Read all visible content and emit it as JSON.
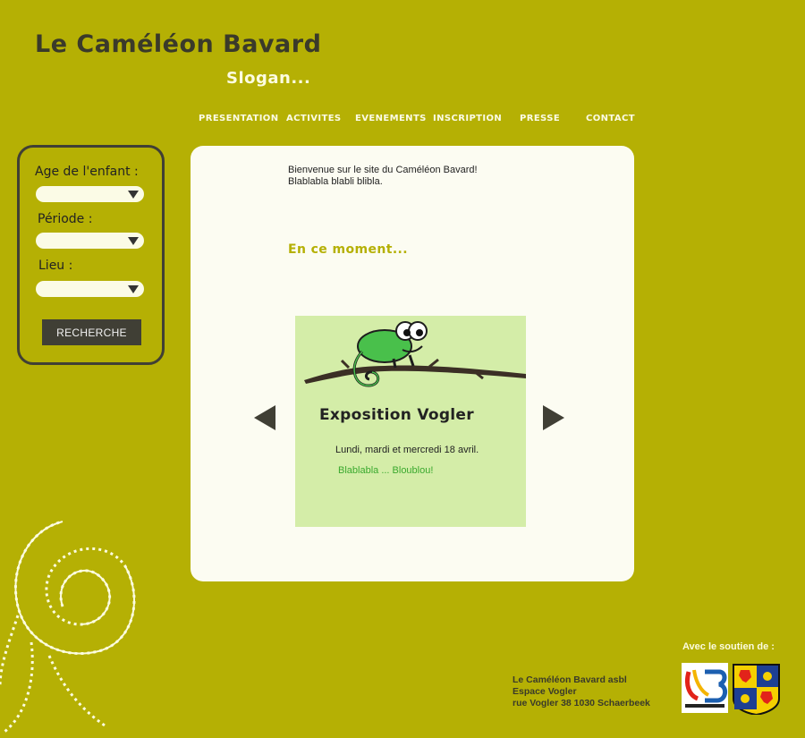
{
  "header": {
    "title": "Le Caméléon Bavard",
    "slogan": "Slogan..."
  },
  "nav": {
    "items": [
      "PRESENTATION",
      "ACTIVITES",
      "EVENEMENTS",
      "INSCRIPTION",
      "PRESSE",
      "CONTACT"
    ]
  },
  "search": {
    "age_label": "Age de l'enfant :",
    "period_label": "Période :",
    "place_label": "Lieu :",
    "age_value": "",
    "period_value": "",
    "place_value": "",
    "button_label": "RECHERCHE"
  },
  "main": {
    "welcome_line1": "Bienvenue sur le site du Caméléon Bavard!",
    "welcome_line2": "Blablabla blabli blibla.",
    "now_heading": "En ce moment...",
    "slide": {
      "title": "Exposition Vogler",
      "date": "Lundi, mardi et mercredi 18 avril.",
      "description": "Blablabla  ... Bloublou!"
    }
  },
  "footer": {
    "support_label": "Avec le soutien de :",
    "address_line1": "Le Caméléon Bavard asbl",
    "address_line2": "Espace Vogler",
    "address_line3": "rue Vogler 38 1030 Schaerbeek"
  },
  "colors": {
    "background": "#b5b004",
    "panel": "#fcfcf2",
    "dark": "#403f35",
    "slide": "#d4eda8",
    "accent_green": "#3aa92e"
  }
}
